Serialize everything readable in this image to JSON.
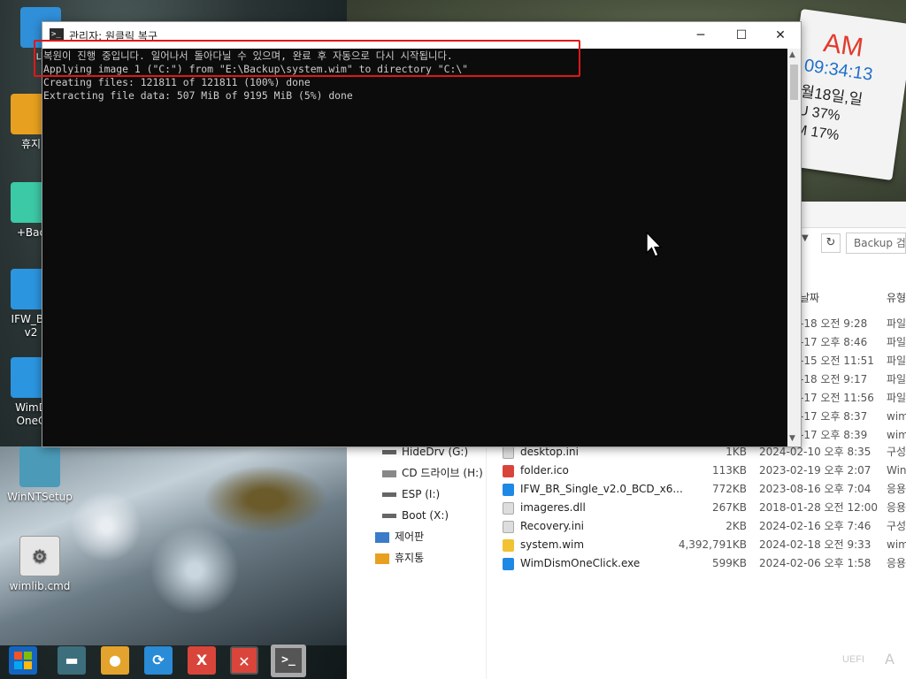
{
  "console": {
    "title": "관리자:  원클릭 복구",
    "icon_glyph": ">_",
    "minimize": "─",
    "maximize": "☐",
    "close": "✕",
    "lines": [
      "복원이 진행 중입니다. 일어나서 돌아다닐 수 있으며, 완료 후 자동으로 다시 시작됩니다.",
      "Applying image 1 (\"C:\") from \"E:\\Backup\\system.wim\" to directory \"C:\\\"",
      "Creating files: 121811 of 121811 (100%) done",
      "Extracting file data: 507 MiB of 9195 MiB (5%) done"
    ]
  },
  "clock": {
    "ampm": "AM",
    "time": "09:34:13",
    "date": "월18일,일",
    "stat1": "U  37%",
    "stat2": "M  17%"
  },
  "desktop_icons": [
    {
      "label": "내",
      "color": "#2f8fd8"
    },
    {
      "label": "휴지",
      "color": "#e8a020"
    },
    {
      "label": "+Bac",
      "color": "#3cc9a6"
    },
    {
      "label": "IFW_BR",
      "label2": "v2",
      "color": "#2b95e0"
    },
    {
      "label": "WimD",
      "label2": "OneC",
      "color": "#2b95e0"
    },
    {
      "label": "WinNTSetup",
      "color": "#4a9ab8"
    },
    {
      "label": "wimlib.cmd",
      "color": "#e6e6e6"
    }
  ],
  "explorer": {
    "search_placeholder": "Backup 검",
    "header_date": "날짜",
    "header_type": "유형",
    "nav": [
      {
        "label": "HideDrv (G:)",
        "icon": "drive-icon"
      },
      {
        "label": "CD 드라이브 (H:)",
        "icon": "cd-drive-icon"
      },
      {
        "label": "ESP (I:)",
        "icon": "drive-icon"
      },
      {
        "label": "Boot (X:)",
        "icon": "drive-icon"
      },
      {
        "label": "제어판",
        "icon": "control-panel-icon"
      },
      {
        "label": "휴지통",
        "icon": "recycle-bin-icon"
      }
    ],
    "partial_rows": [
      {
        "date": "-18 오전 9:28",
        "type": "파일"
      },
      {
        "date": "-17 오후 8:46",
        "type": "파일"
      },
      {
        "date": "-15 오전 11:51",
        "type": "파일"
      },
      {
        "date": "-18 오전 9:17",
        "type": "파일"
      },
      {
        "date": "-17 오전 11:56",
        "type": "파일"
      },
      {
        "date": "-17 오후 8:37",
        "type": "wim"
      },
      {
        "date": "-17 오후 8:39",
        "type": "wim"
      }
    ],
    "files": [
      {
        "name": "desktop.ini",
        "size": "1KB",
        "date": "2024-02-10 오후 8:35",
        "type": "구성",
        "color": "#dddddd"
      },
      {
        "name": "folder.ico",
        "size": "113KB",
        "date": "2023-02-19 오후 2:07",
        "type": "Wind",
        "color": "#d9443a"
      },
      {
        "name": "IFW_BR_Single_v2.0_BCD_x6...",
        "size": "772KB",
        "date": "2023-08-16 오후 7:04",
        "type": "응용",
        "color": "#1e88e5"
      },
      {
        "name": "imageres.dll",
        "size": "267KB",
        "date": "2018-01-28 오전 12:00",
        "type": "응용",
        "color": "#dddddd"
      },
      {
        "name": "Recovery.ini",
        "size": "2KB",
        "date": "2024-02-16 오후 7:46",
        "type": "구성",
        "color": "#dddddd"
      },
      {
        "name": "system.wim",
        "size": "4,392,791KB",
        "date": "2024-02-18 오전 9:33",
        "type": "wim",
        "color": "#f1c232"
      },
      {
        "name": "WimDismOneClick.exe",
        "size": "599KB",
        "date": "2024-02-06 오후 1:58",
        "type": "응용",
        "color": "#1e88e5"
      }
    ]
  },
  "taskbar": {
    "items": [
      {
        "name": "start-button",
        "glyph": "",
        "color": "#1565c0"
      },
      {
        "name": "taskbar-app-1",
        "glyph": "▬",
        "color": "#3d6e7c"
      },
      {
        "name": "taskbar-app-2",
        "glyph": "●",
        "color": "#e3a32c"
      },
      {
        "name": "taskbar-app-3",
        "glyph": "⟳",
        "color": "#2a8bd6"
      },
      {
        "name": "taskbar-app-4",
        "glyph": "X",
        "color": "#d9453a"
      },
      {
        "name": "taskbar-app-5",
        "glyph": "✕",
        "color": "#d9453a"
      },
      {
        "name": "taskbar-console",
        "glyph": ">_",
        "color": "#555555"
      }
    ],
    "uefi_label": "UEFI",
    "ime_label": "A"
  }
}
